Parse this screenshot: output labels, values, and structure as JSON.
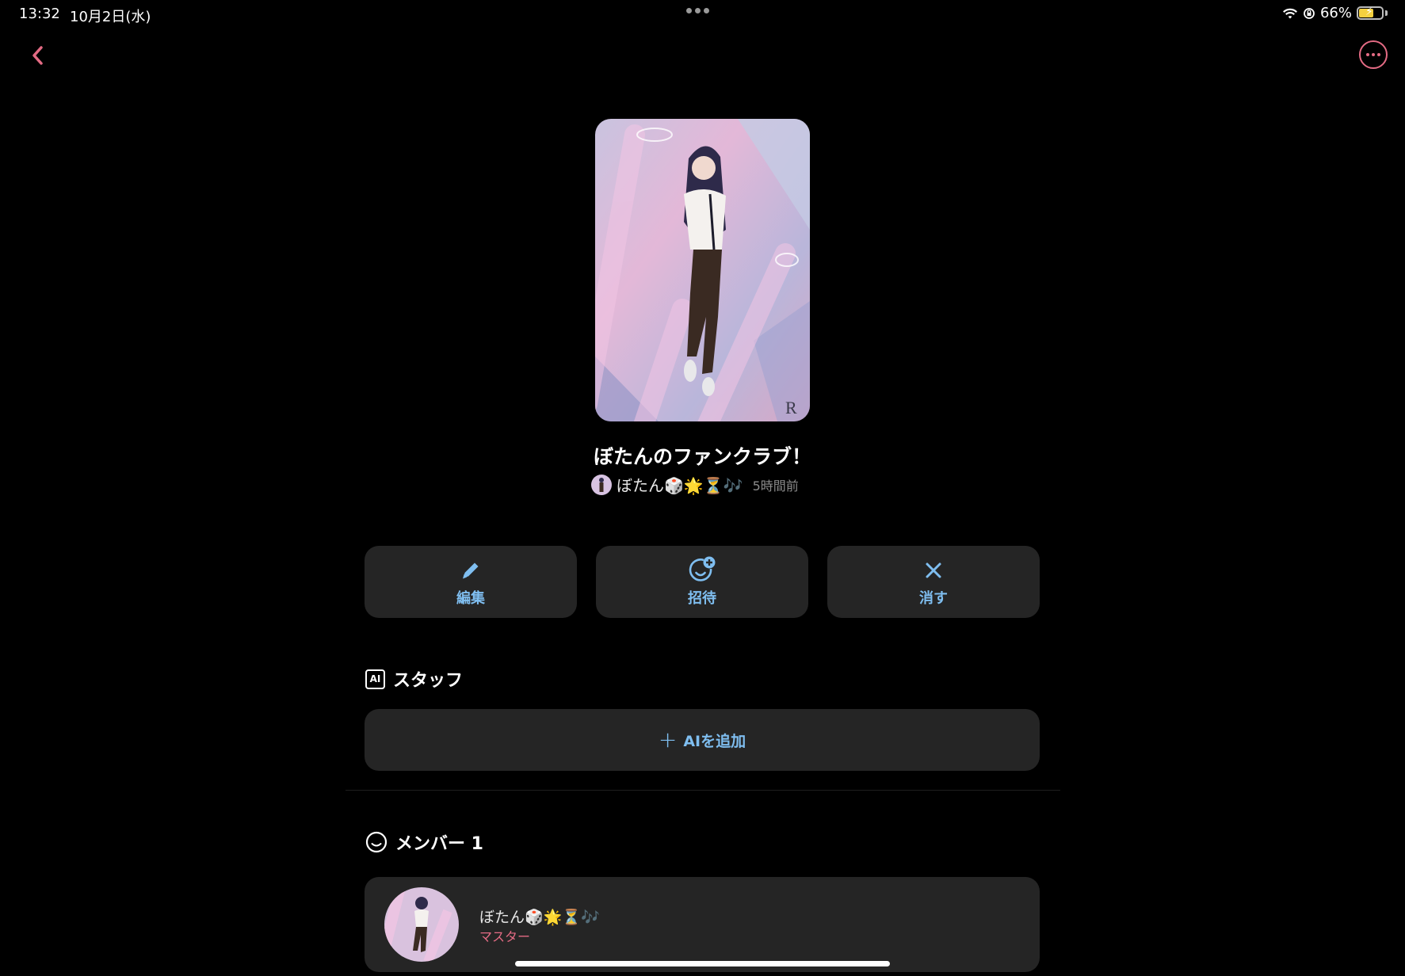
{
  "status": {
    "time": "13:32",
    "date": "10月2日(水)",
    "battery": "66%",
    "battery_level": 0.66
  },
  "club": {
    "title": "ぼたんのファンクラブ！",
    "owner_name": "ぼたん🎲🌟⏳🎶",
    "posted": "5時間前"
  },
  "actions": {
    "edit": "編集",
    "invite": "招待",
    "delete": "消す"
  },
  "staff": {
    "badge": "AI",
    "title": "スタッフ",
    "add_label": "AIを追加"
  },
  "members": {
    "title": "メンバー 1",
    "list": [
      {
        "name": "ぼたん🎲🌟⏳🎶",
        "role": "マスター"
      }
    ]
  },
  "icons": {
    "back": "chevron-left-icon",
    "more": "more-horizontal-icon",
    "edit": "pencil-icon",
    "invite": "add-person-icon",
    "delete": "close-icon",
    "members": "smile-face-icon"
  },
  "colors": {
    "accent_pink": "#e46b84",
    "accent_blue": "#7fbef0",
    "card_bg": "#252525"
  }
}
